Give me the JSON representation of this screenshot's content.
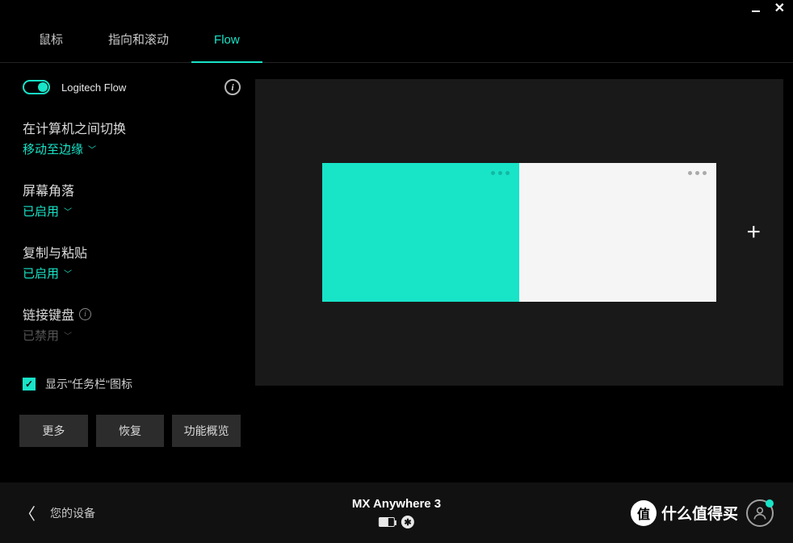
{
  "window": {
    "min": "—",
    "close": "✕"
  },
  "tabs": [
    {
      "label": "鼠标",
      "active": false
    },
    {
      "label": "指向和滚动",
      "active": false
    },
    {
      "label": "Flow",
      "active": true
    }
  ],
  "flow": {
    "name": "Logitech Flow",
    "settings": {
      "switch": {
        "title": "在计算机之间切换",
        "value": "移动至边缘"
      },
      "corner": {
        "title": "屏幕角落",
        "value": "已启用"
      },
      "copypaste": {
        "title": "复制与粘贴",
        "value": "已启用"
      },
      "keyboard": {
        "title": "链接键盘",
        "value": "已禁用"
      }
    },
    "taskbar": {
      "label": "显示\"任务栏\"图标"
    }
  },
  "buttons": {
    "more": "更多",
    "restore": "恢复",
    "overview": "功能概览"
  },
  "canvas": {
    "add": "+"
  },
  "footer": {
    "devices_label": "您的设备",
    "device_name": "MX Anywhere 3",
    "watermark_badge": "值",
    "watermark_text": "什么值得买"
  }
}
